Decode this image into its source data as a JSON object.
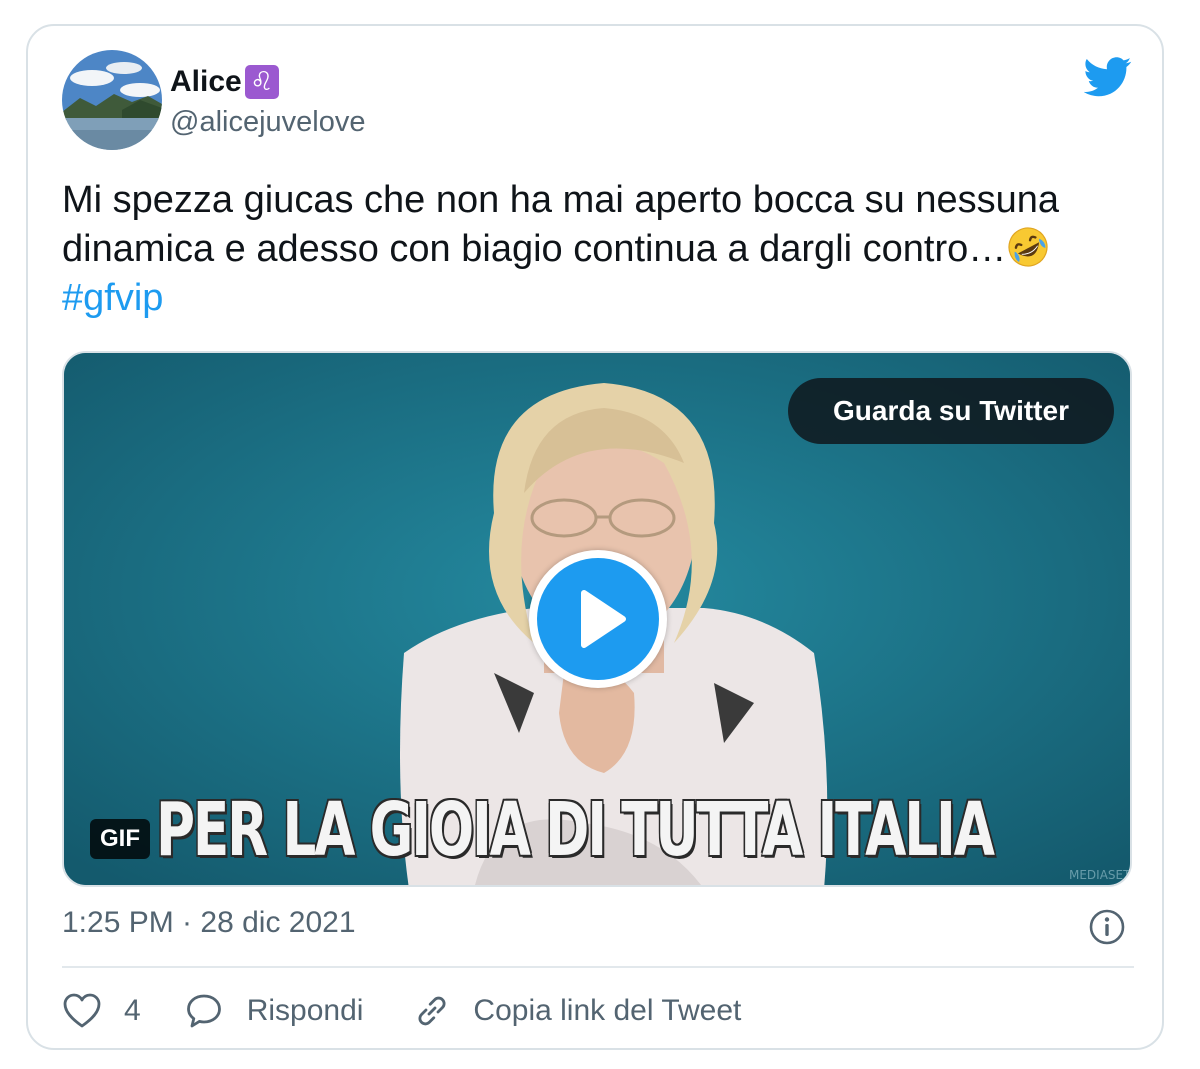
{
  "author": {
    "display_name": "Alice",
    "zodiac_emoji": "♌",
    "handle": "@alicejuvelove",
    "avatar_icon": "lake-landscape-avatar"
  },
  "brand_icon": "twitter-bird-icon",
  "tweet": {
    "text_line1": "Mi spezza giucas che non ha mai aperto bocca su nessuna",
    "text_line2": "dinamica e adesso con biagio continua a dargli contro…",
    "emoji": "rolling-on-the-floor-laughing-emoji",
    "hashtag": "#gfvip"
  },
  "media": {
    "watch_button_label": "Guarda su Twitter",
    "caption": "PER LA GIOIA DI TUTTA ITALIA",
    "badge": "GIF",
    "play_icon": "play-icon"
  },
  "meta": {
    "timestamp": "1:25 PM · 28 dic 2021",
    "info_icon": "info-icon"
  },
  "actions": {
    "like_count": "4",
    "reply_label": "Rispondi",
    "copy_link_label": "Copia link del Tweet"
  },
  "colors": {
    "accent": "#1d9bf0",
    "text": "#0f1419",
    "secondary": "#536471",
    "border": "#d9e1e6",
    "media_background": "#1b6f85"
  }
}
